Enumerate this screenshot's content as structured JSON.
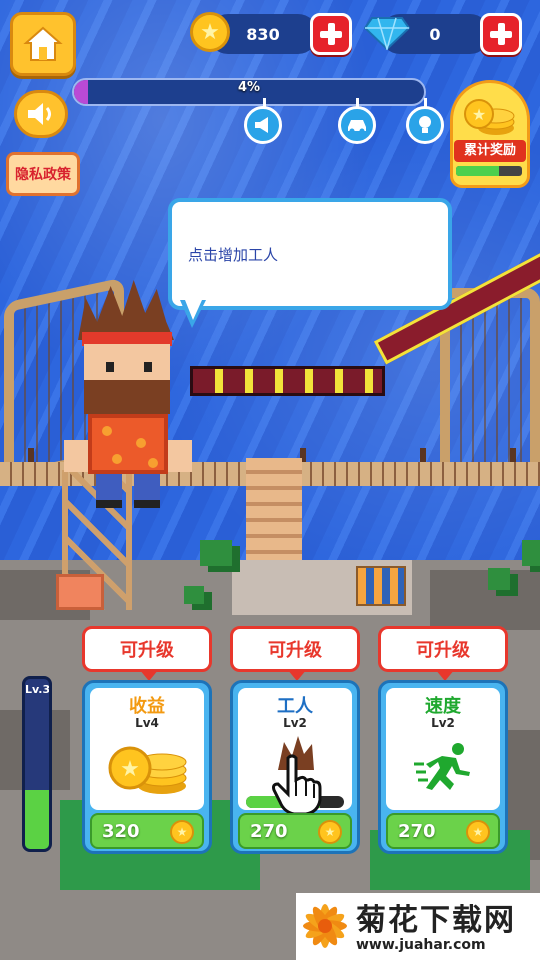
{
  "hud": {
    "coins": "830",
    "gems": "0",
    "progress_text": "4%",
    "progress_value": 0.04,
    "privacy_label": "隐私政策",
    "milestone_icons": [
      "megaphone-icon",
      "car-icon",
      "lightbulb-icon"
    ]
  },
  "reward": {
    "label": "累计奖励",
    "progress": 0.65
  },
  "tip": {
    "text": "点击增加工人"
  },
  "level": {
    "label": "Lv.3",
    "fill": 0.35
  },
  "upgrades": [
    {
      "tag": "可升级",
      "title": "收益",
      "level": "Lv4",
      "price": "320",
      "icon": "coins-icon",
      "title_color": "#f39a12"
    },
    {
      "tag": "可升级",
      "title": "工人",
      "level": "Lv2",
      "price": "270",
      "icon": "worker-icon",
      "title_color": "#1e6fc4",
      "progress": 0.75
    },
    {
      "tag": "可升级",
      "title": "速度",
      "level": "Lv2",
      "price": "270",
      "icon": "running-man-icon",
      "title_color": "#1fa82e"
    }
  ],
  "watermark": {
    "title": "菊花下载网",
    "url": "www.juahar.com"
  },
  "colors": {
    "accent_red": "#e8372c",
    "price_green": "#6bd24a",
    "card_blue": "#49b4f0",
    "gold": "#ffc22d"
  }
}
